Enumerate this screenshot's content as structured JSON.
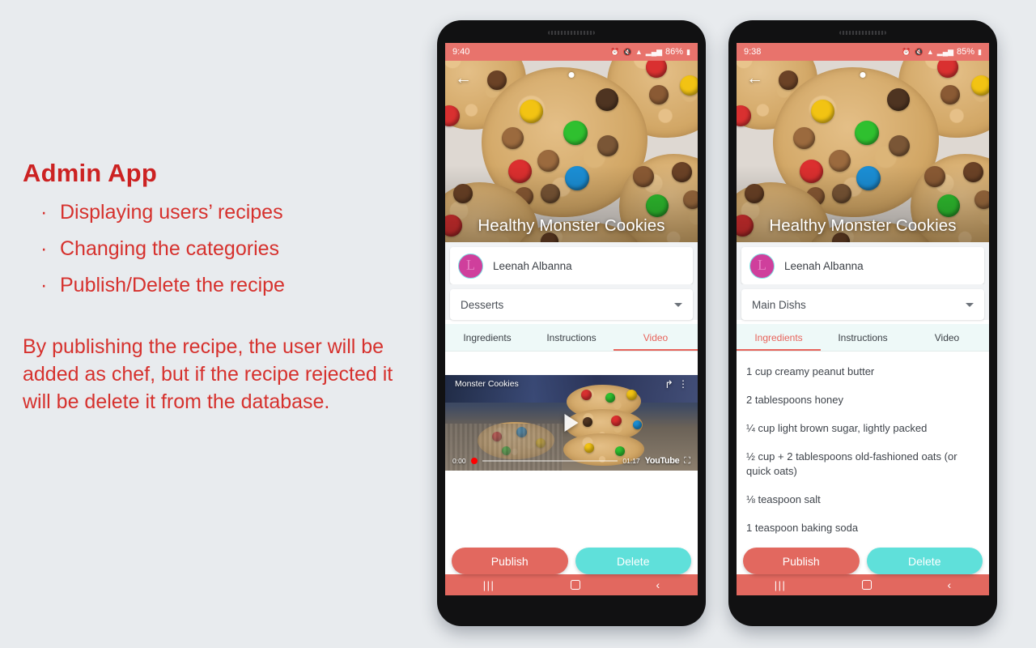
{
  "slide": {
    "title": "Admin App",
    "bullets": [
      "Displaying users’ recipes",
      "Changing the categories",
      "Publish/Delete the recipe"
    ],
    "paragraph": "By publishing the recipe, the user will be added as chef, but if the recipe rejected it will be delete it from the database.",
    "bullet_glyph": "·",
    "accent_color": "#d6312d",
    "background_color": "#e8ebee"
  },
  "theme": {
    "publish_color": "#e2685f",
    "delete_color": "#5fe0da",
    "tab_active_color": "#e8635b",
    "tab_bar_background": "#eef9f8",
    "status_bar_color": "#e8736c",
    "avatar_color": "#cf3f9c"
  },
  "phone1": {
    "status": {
      "time": "9:40",
      "battery": "86%",
      "icons": [
        "alarm-icon",
        "mute-icon",
        "wifi-icon",
        "signal-icon",
        "battery-icon"
      ]
    },
    "hero": {
      "title": "Healthy Monster Cookies",
      "back_icon": "back-arrow-icon"
    },
    "chef": {
      "name": "Leenah Albanna",
      "avatar_letter": "L"
    },
    "category": {
      "value": "Desserts",
      "caret_icon": "chevron-down-icon"
    },
    "tabs": [
      {
        "label": "Ingredients",
        "active": false
      },
      {
        "label": "Instructions",
        "active": false
      },
      {
        "label": "Video",
        "active": true
      }
    ],
    "video": {
      "title": "Monster Cookies",
      "current_time": "0:00",
      "duration": "01:17",
      "brand": "YouTube",
      "share_icon": "share-icon",
      "menu_icon": "more-vertical-icon",
      "play_icon": "play-icon",
      "fullscreen_icon": "fullscreen-icon"
    },
    "actions": {
      "publish": "Publish",
      "delete": "Delete"
    },
    "nav": {
      "recents": "|||",
      "home": "home-icon",
      "back": "‹"
    }
  },
  "phone2": {
    "status": {
      "time": "9:38",
      "battery": "85%",
      "icons": [
        "alarm-icon",
        "mute-icon",
        "wifi-icon",
        "signal-icon",
        "battery-icon"
      ]
    },
    "hero": {
      "title": "Healthy Monster Cookies",
      "back_icon": "back-arrow-icon"
    },
    "chef": {
      "name": "Leenah Albanna",
      "avatar_letter": "L"
    },
    "category": {
      "value": "Main Dishs",
      "caret_icon": "chevron-down-icon"
    },
    "tabs": [
      {
        "label": "Ingredients",
        "active": true
      },
      {
        "label": "Instructions",
        "active": false
      },
      {
        "label": "Video",
        "active": false
      }
    ],
    "ingredients": [
      "1 cup creamy peanut butter",
      "2 tablespoons honey",
      "¼ cup light brown sugar, lightly packed",
      "½ cup + 2 tablespoons old-fashioned oats (or quick oats)",
      "⅛ teaspoon salt",
      "1 teaspoon baking soda"
    ],
    "actions": {
      "publish": "Publish",
      "delete": "Delete"
    },
    "nav": {
      "recents": "|||",
      "home": "home-icon",
      "back": "‹"
    }
  }
}
